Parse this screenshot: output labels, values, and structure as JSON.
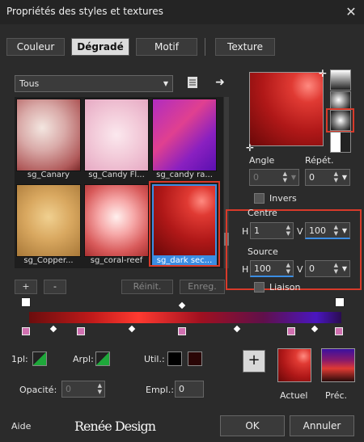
{
  "window": {
    "title": "Propriétés des styles et textures",
    "close": "✕"
  },
  "tabs": [
    {
      "label": "Couleur"
    },
    {
      "label": "Dégradé"
    },
    {
      "label": "Motif"
    },
    {
      "label": "Texture"
    }
  ],
  "category": {
    "selected": "Tous"
  },
  "thumbnails": [
    {
      "label": "sg_Canary"
    },
    {
      "label": "sg_Candy Fl..."
    },
    {
      "label": "sg_candy ra..."
    },
    {
      "label": "sg_Copper..."
    },
    {
      "label": "sg_coral-reef"
    },
    {
      "label": "sg_dark sec..."
    }
  ],
  "buttons": {
    "add": "+",
    "remove": "-",
    "reset": "Réinit.",
    "save": "Enreg.",
    "ok": "OK",
    "cancel": "Annuler",
    "help": "Aide",
    "add_color": "+"
  },
  "gradient": {
    "angle_label": "Angle",
    "angle_value": "0",
    "repeat_label": "Répét.",
    "repeat_value": "0",
    "invert_label": "Invers",
    "center_label": "Centre",
    "center_h": "1",
    "center_v": "100",
    "source_label": "Source",
    "source_h": "100",
    "source_v": "0",
    "link_label": "Liaison",
    "h_label": "H",
    "v_label": "V"
  },
  "bottom": {
    "fg_label": "1pl:",
    "bg_label": "Arpl:",
    "util_label": "Util.:",
    "opacity_label": "Opacité:",
    "opacity_value": "0",
    "empl_label": "Empl.:",
    "empl_value": "0",
    "current_label": "Actuel",
    "previous_label": "Préc."
  },
  "logo": "Renée Design",
  "colors": {
    "accent": "#3b8de3",
    "highlight": "#d83a2a"
  }
}
